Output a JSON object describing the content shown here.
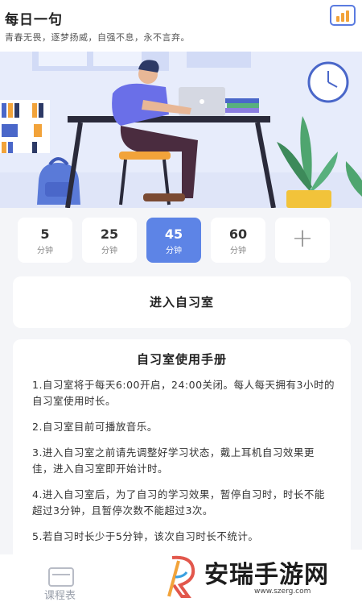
{
  "header": {
    "title": "每日一句",
    "motto": "青春无畏，逐梦扬威，自强不息，永不言弃。"
  },
  "colors": {
    "accent": "#5d84e6",
    "stats_icon_border": "#5a7be0",
    "stats_icon_bars": "#f2a33a"
  },
  "icons": {
    "stats": "bar-chart-icon",
    "tab_course": "course-icon",
    "hero": "study-illustration"
  },
  "timers": [
    {
      "num": "5",
      "unit": "分钟"
    },
    {
      "num": "25",
      "unit": "分钟"
    },
    {
      "num": "45",
      "unit": "分钟"
    },
    {
      "num": "60",
      "unit": "分钟"
    }
  ],
  "selected_timer": "45",
  "add_timer_label": "+",
  "enter_label": "进入自习室",
  "manual": {
    "title": "自习室使用手册",
    "items": [
      "1.自习室将于每天6:00开启，24:00关闭。每人每天拥有3小时的自习室使用时长。",
      "2.自习室目前可播放音乐。",
      "3.进入自习室之前请先调整好学习状态，戴上耳机自习效果更佳，进入自习室即开始计时。",
      "4.进入自习室后，为了自习的学习效果，暂停自习时，时长不能超过3分钟，且暂停次数不能超过3次。",
      "5.若自习时长少于5分钟，该次自习时长不统计。"
    ]
  },
  "tabbar": {
    "course_label": "课程表"
  },
  "watermark": {
    "name": "安瑞手游网",
    "url": "www.szerg.com"
  }
}
